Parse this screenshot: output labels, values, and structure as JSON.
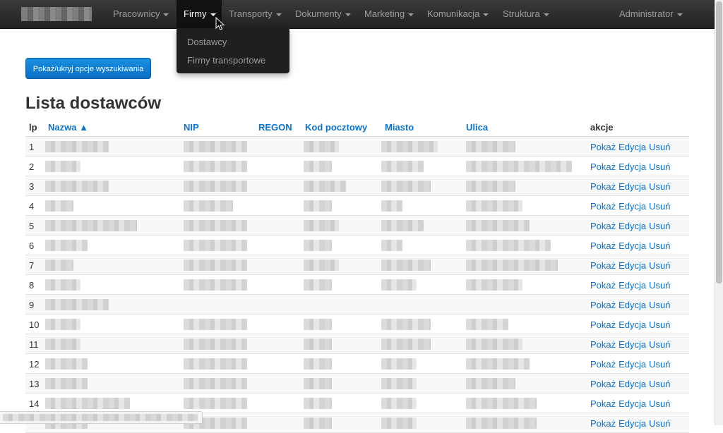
{
  "navbar": {
    "items": [
      {
        "label": "Pracownicy"
      },
      {
        "label": "Firmy"
      },
      {
        "label": "Transporty"
      },
      {
        "label": "Dokumenty"
      },
      {
        "label": "Marketing"
      },
      {
        "label": "Komunikacja"
      },
      {
        "label": "Struktura"
      },
      {
        "label": "Administrator"
      }
    ],
    "active_index": 1
  },
  "dropdown": {
    "items": [
      {
        "label": "Dostawcy"
      },
      {
        "label": "Firmy transportowe"
      }
    ]
  },
  "search_toggle_label": "Pokaż/ukryj opcje wyszukiwania",
  "page_title": "Lista dostawców",
  "table": {
    "headers": {
      "lp": "lp",
      "nazwa": "Nazwa ▲",
      "nip": "NIP",
      "regon": "REGON",
      "kod": "Kod pocztowy",
      "miasto": "Miasto",
      "ulica": "Ulica",
      "akcje": "akcje"
    },
    "actions": {
      "show": "Pokaż",
      "edit": "Edycja",
      "delete": "Usuń"
    },
    "rows": [
      {
        "lp": "1"
      },
      {
        "lp": "2"
      },
      {
        "lp": "3"
      },
      {
        "lp": "4"
      },
      {
        "lp": "5"
      },
      {
        "lp": "6"
      },
      {
        "lp": "7"
      },
      {
        "lp": "8"
      },
      {
        "lp": "9"
      },
      {
        "lp": "10"
      },
      {
        "lp": "11"
      },
      {
        "lp": "12"
      },
      {
        "lp": "13"
      },
      {
        "lp": "14"
      },
      {
        "lp": ""
      }
    ]
  },
  "colors": {
    "navbar_bg": "#222222",
    "link": "#0a72c9",
    "button": "#0a6fc4"
  }
}
